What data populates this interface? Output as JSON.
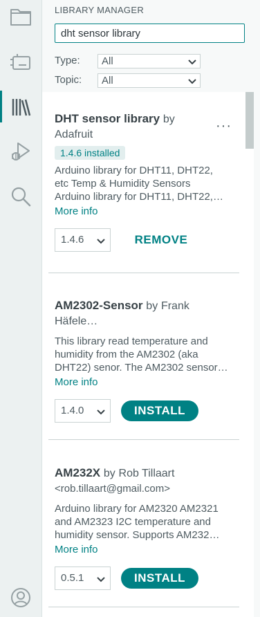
{
  "activity_bar": {
    "icons": [
      "folder-icon",
      "board-icon",
      "library-icon",
      "debug-icon",
      "search-icon",
      "account-icon"
    ]
  },
  "panel": {
    "title": "LIBRARY MANAGER",
    "search_value": "dht sensor library",
    "type_label": "Type:",
    "type_value": "All",
    "topic_label": "Topic:",
    "topic_value": "All"
  },
  "libraries": [
    {
      "name": "DHT sensor library",
      "by": "by",
      "author": "Adafruit",
      "installed_badge": "1.4.6 installed",
      "description_1": "Arduino library for DHT11, DHT22,",
      "description_2": "etc Temp & Humidity Sensors",
      "description_3": "Arduino library for DHT11, DHT22,…",
      "more_info": "More info",
      "version": "1.4.6",
      "action": "REMOVE",
      "overflow": "···"
    },
    {
      "name": "AM2302-Sensor",
      "by": "by",
      "author": "Frank",
      "author_2": "Häfele…",
      "description_1": "This library read temperature and",
      "description_2": "humidity from the AM2302 (aka",
      "description_3": "DHT22) senor. The AM2302 sensor…",
      "more_info": "More info",
      "version": "1.4.0",
      "action": "INSTALL"
    },
    {
      "name": "AM232X",
      "by": "by",
      "author": "Rob Tillaart",
      "author_2": "<rob.tillaart@gmail.com>",
      "description_1": "Arduino library for AM2320 AM2321",
      "description_2": "and AM2323 I2C temperature and",
      "description_3": "humidity sensor. Supports AM232…",
      "more_info": "More info",
      "version": "0.5.1",
      "action": "INSTALL"
    }
  ]
}
